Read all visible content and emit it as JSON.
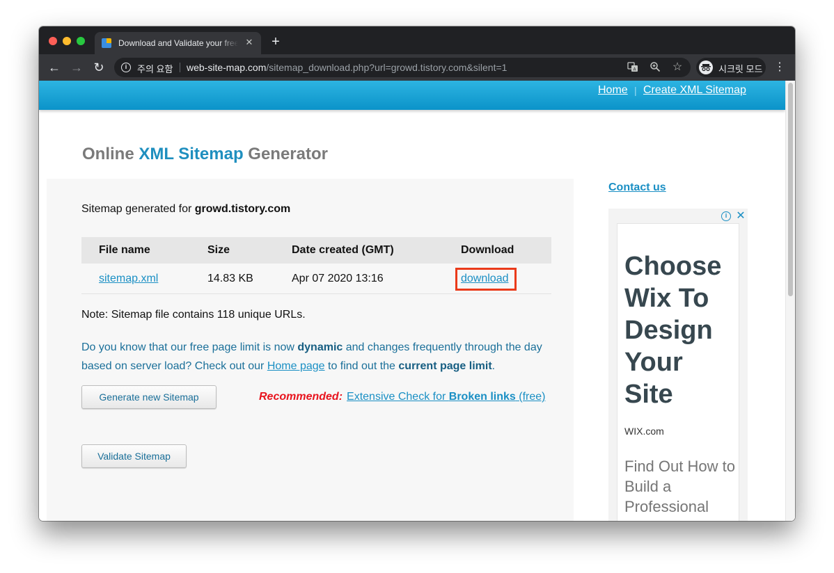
{
  "browser": {
    "tab_title": "Download and Validate your free XML Sitemap",
    "tab_close": "✕",
    "new_tab": "+",
    "security_label": "주의 요함",
    "url_host": "web-site-map.com",
    "url_path": "/sitemap_download.php?url=growd.tistory.com&silent=1",
    "incognito_label": "시크릿 모드",
    "icons": [
      "back-arrow-icon",
      "forward-arrow-icon",
      "reload-icon",
      "info-icon",
      "translate-icon",
      "zoom-icon",
      "star-icon",
      "incognito-icon",
      "more-vert-icon"
    ]
  },
  "header": {
    "nav_home": "Home",
    "nav_sep": "|",
    "nav_create": "Create XML Sitemap"
  },
  "page": {
    "title_pre": "Online ",
    "title_accent": "XML Sitemap",
    "title_post": " Generator",
    "generated_for_label": "Sitemap generated for ",
    "generated_for_site": "growd.tistory.com",
    "table": {
      "headers": [
        "File name",
        "Size",
        "Date created (GMT)",
        "Download"
      ],
      "rows": [
        {
          "file": "sitemap.xml",
          "size": "14.83 KB",
          "date": "Apr 07 2020 13:16",
          "download": "download"
        }
      ]
    },
    "note": "Note: Sitemap file contains 118 unique URLs.",
    "info": {
      "t1": "Do you know that our free page limit is now ",
      "b1": "dynamic",
      "t2": " and changes frequently through the day based on server load? Check out our ",
      "link": "Home page",
      "t3": " to find out the ",
      "b2": "current page limit",
      "t4": "."
    },
    "btn_generate": "Generate new Sitemap",
    "btn_validate": "Validate Sitemap",
    "recommended_label": "Recommended:",
    "rec_link_pre": "Extensive Check for ",
    "rec_link_bold": "Broken links",
    "rec_link_post": " (free)"
  },
  "sidebar": {
    "contact": "Contact us",
    "ad": {
      "info_icon": "i",
      "close_icon": "✕",
      "headline": "Choose Wix To Design Your Site",
      "brand": "WIX.com",
      "sub": "Find Out How to Build a Professional Web Presence"
    }
  },
  "colors": {
    "accent": "#1f8fbf",
    "link": "#1a8fc4",
    "recommended": "#e8141e",
    "highlight_box": "#ea3a1a",
    "header_band": "#0b93c9"
  }
}
